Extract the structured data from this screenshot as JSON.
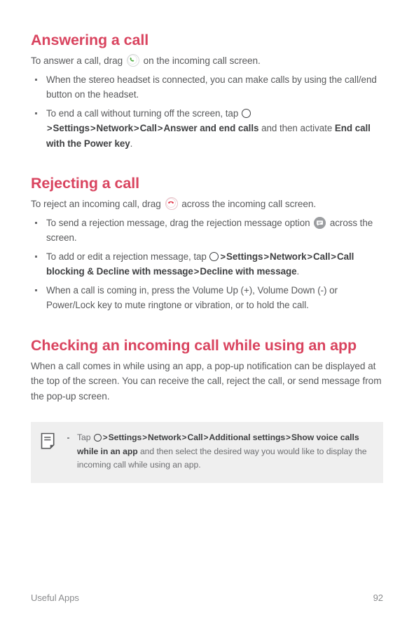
{
  "document": {
    "sections": [
      {
        "id": "answering-a-call",
        "heading": "Answering a call",
        "intro_before": "To answer a call, drag",
        "intro_icon": "answer-call-icon",
        "intro_after": "on the incoming call screen.",
        "bullets": [
          {
            "id": "stereo-headset",
            "text": "When the stereo headset is connected, you can make calls by using the call/end button on the headset."
          },
          {
            "id": "end-call-without-screen-off",
            "lead": "To end a call without turning off the screen, tap",
            "icon": "home-button-icon",
            "path": [
              "Settings",
              "Network",
              "Call",
              "Answer and end calls"
            ],
            "middle": "and then activate",
            "emphasis": "End call with the Power key",
            "trailing": "."
          }
        ]
      },
      {
        "id": "rejecting-a-call",
        "heading": "Rejecting a call",
        "intro_before": "To reject an incoming call, drag",
        "intro_icon": "reject-call-icon",
        "intro_after": "across the incoming call screen.",
        "bullets": [
          {
            "id": "send-rejection-message",
            "lead": "To send a rejection message, drag the rejection message option",
            "icon": "message-option-icon",
            "trailing_text": "across the screen."
          },
          {
            "id": "add-edit-rejection-message",
            "lead": "To add or edit a rejection message, tap",
            "icon": "home-button-icon",
            "path": [
              "Settings",
              "Network",
              "Call",
              "Call blocking & Decline with message",
              "Decline with message"
            ],
            "trailing": "."
          },
          {
            "id": "mute-ringtone",
            "text": "When a call is coming in, press the Volume Up (+), Volume Down (-) or Power/Lock key to mute ringtone or vibration, or to hold the call."
          }
        ]
      },
      {
        "id": "checking-incoming-call-while-using-app",
        "heading": "Checking an incoming call while using an app",
        "paragraph": "When a call comes in while using an app, a pop-up notification can be displayed at the top of the screen. You can receive the call, reject the call, or send message from the pop-up screen."
      }
    ],
    "note": {
      "id": "note-show-voice-calls",
      "icon": "note-icon",
      "lead": "Tap",
      "inline_icon": "home-button-icon",
      "path": [
        "Settings",
        "Network",
        "Call",
        "Additional settings",
        "Show voice calls while in an app"
      ],
      "after": "and then select the desired way you would like to display the incoming call while using an app."
    },
    "footer": {
      "chapter": "Useful Apps",
      "page_number": "92"
    },
    "colors": {
      "heading": "#d9445f",
      "body": "#58595b",
      "bold": "#3f4042",
      "note_background": "#efefef",
      "footer": "#8a8b8d",
      "answer_icon": "#4bab3d",
      "reject_icon": "#e0283c"
    }
  }
}
